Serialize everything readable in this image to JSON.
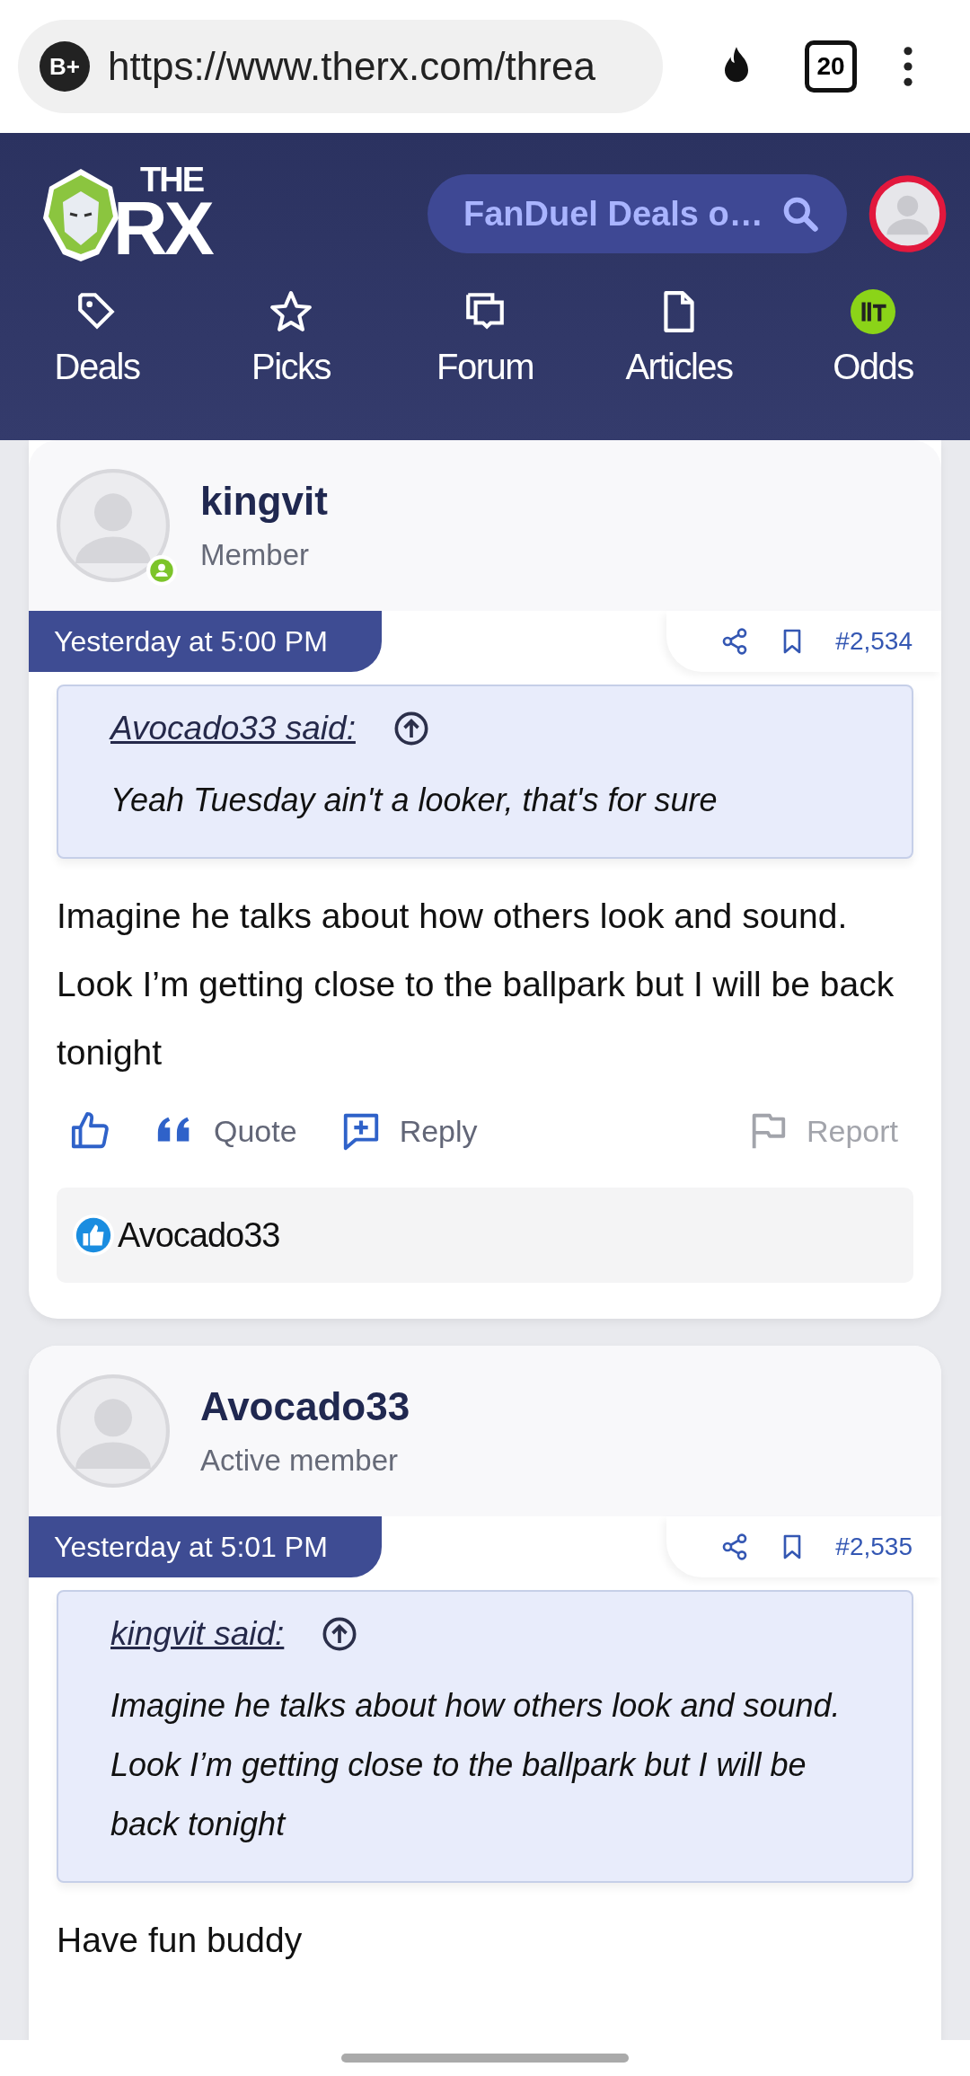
{
  "browser": {
    "badge": "B+",
    "url": "https://www.therx.com/threa",
    "tab_count": "20"
  },
  "header": {
    "logo_top": "THE",
    "logo_bottom": "RX",
    "search": {
      "value": "FanDuel Deals o…"
    }
  },
  "nav": [
    {
      "label": "Deals",
      "kind": "tag"
    },
    {
      "label": "Picks",
      "kind": "star"
    },
    {
      "label": "Forum",
      "kind": "chat"
    },
    {
      "label": "Articles",
      "kind": "doc"
    },
    {
      "label": "Odds",
      "kind": "odds"
    }
  ],
  "posts": [
    {
      "author": "kingvit",
      "role": "Member",
      "online": true,
      "date": "Yesterday at 5:00 PM",
      "number": "#2,534",
      "quote": {
        "attribution": "Avocado33 said:",
        "text": "Yeah Tuesday ain't a looker, that's for sure"
      },
      "body": "Imagine he talks about how others look and sound. Look I’m getting close to the ballpark but I will be back tonight",
      "actions": {
        "quote": "Quote",
        "reply": "Reply",
        "report": "Report"
      },
      "reactions": "Avocado33"
    },
    {
      "author": "Avocado33",
      "role": "Active member",
      "online": false,
      "date": "Yesterday at 5:01 PM",
      "number": "#2,535",
      "quote": {
        "attribution": "kingvit said:",
        "text": "Imagine he talks about how others look and sound. Look I’m getting close to the ballpark but I will be back tonight"
      },
      "body": "Have fun buddy"
    }
  ]
}
